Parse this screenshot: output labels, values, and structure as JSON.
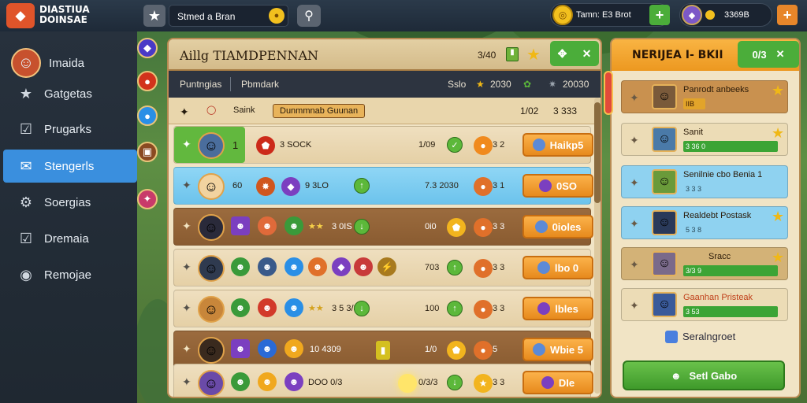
{
  "app": {
    "logo_text_line1": "DIASTIUA",
    "logo_text_line2": "DOINSAE"
  },
  "topbar": {
    "search_value": "Stmed a Bran",
    "resource1_text": "Tamn: E3 Brot",
    "resource2_text": "3369B",
    "plus_icon": "+"
  },
  "sidebar": {
    "items": [
      {
        "label": "Imaida",
        "icon": "avatar"
      },
      {
        "label": "Gatgetas",
        "icon": "star-icon"
      },
      {
        "label": "Prugarks",
        "icon": "check-icon"
      },
      {
        "label": "Stengerls",
        "icon": "envelope-icon",
        "active": true
      },
      {
        "label": "Soergias",
        "icon": "gear-icon"
      },
      {
        "label": "Dremaia",
        "icon": "check-icon"
      },
      {
        "label": "Remojae",
        "icon": "circle-icon"
      }
    ]
  },
  "main": {
    "title": "Aillg TIAMDPENNAN",
    "count": "3/40",
    "tabs": {
      "a": "Puntngias",
      "b": "Pbmdark",
      "stat1_label": "Sslo",
      "stat1": "2030",
      "stat2": "20030"
    },
    "col": {
      "label": "Saink",
      "badge": "Dunmmnab Guunan",
      "right": "1/02",
      "right2": "3 333"
    },
    "rows": [
      {
        "rank": "1",
        "tag": "3 SOCK",
        "num": "1/09",
        "lvl": "3 2",
        "btn": "Haikp5",
        "style": "green"
      },
      {
        "rank": "60",
        "tag": "9 3LO",
        "num": "7.3 2030",
        "lvl": "3 1",
        "btn": "0SO",
        "style": "blue"
      },
      {
        "rank": "",
        "tag": "3 0IS",
        "num": "0i0",
        "lvl": "3 3",
        "btn": "0ioles",
        "style": "brown"
      },
      {
        "rank": "",
        "tag": "",
        "num": "703",
        "lvl": "3 3",
        "btn": "lbo 0",
        "style": "tan"
      },
      {
        "rank": "",
        "tag": "3 5 3/3",
        "num": "100",
        "lvl": "3 3",
        "btn": "lbles",
        "style": "tan"
      },
      {
        "rank": "",
        "tag": "10 4309",
        "num": "1/0",
        "lvl": "5",
        "btn": "Wbie 5",
        "style": "brown"
      },
      {
        "rank": "",
        "tag": "DOO 0/3",
        "num": "0/3/3",
        "lvl": "3 3",
        "btn": "DIe",
        "style": "tan"
      }
    ]
  },
  "right": {
    "title": "NERIJEA I- BKII",
    "close_count": "0/3",
    "items": [
      {
        "name": "Panrodt anbeeks",
        "sub": "IIB",
        "bar": "",
        "color": "#d2a060"
      },
      {
        "name": "Sanit",
        "sub": "",
        "bar": "3 36 0",
        "color": "#e7d3a7"
      },
      {
        "name": "Senilnie cbo Benia 1",
        "sub": "3 3 3",
        "bar": "",
        "color": "#8fd2f0"
      },
      {
        "name": "Realdebt Postask",
        "sub": "5 3 8",
        "bar": "",
        "color": "#8fd2f0"
      },
      {
        "name": "Sracc",
        "sub": "",
        "bar": "3/3 9",
        "color": "#d3b277"
      },
      {
        "name": "Gaanhan Pristeak",
        "sub": "",
        "bar": "3 53",
        "color": "#e7d3a7"
      }
    ],
    "footer": "Seralngroet",
    "button": "Setl Gabo"
  }
}
